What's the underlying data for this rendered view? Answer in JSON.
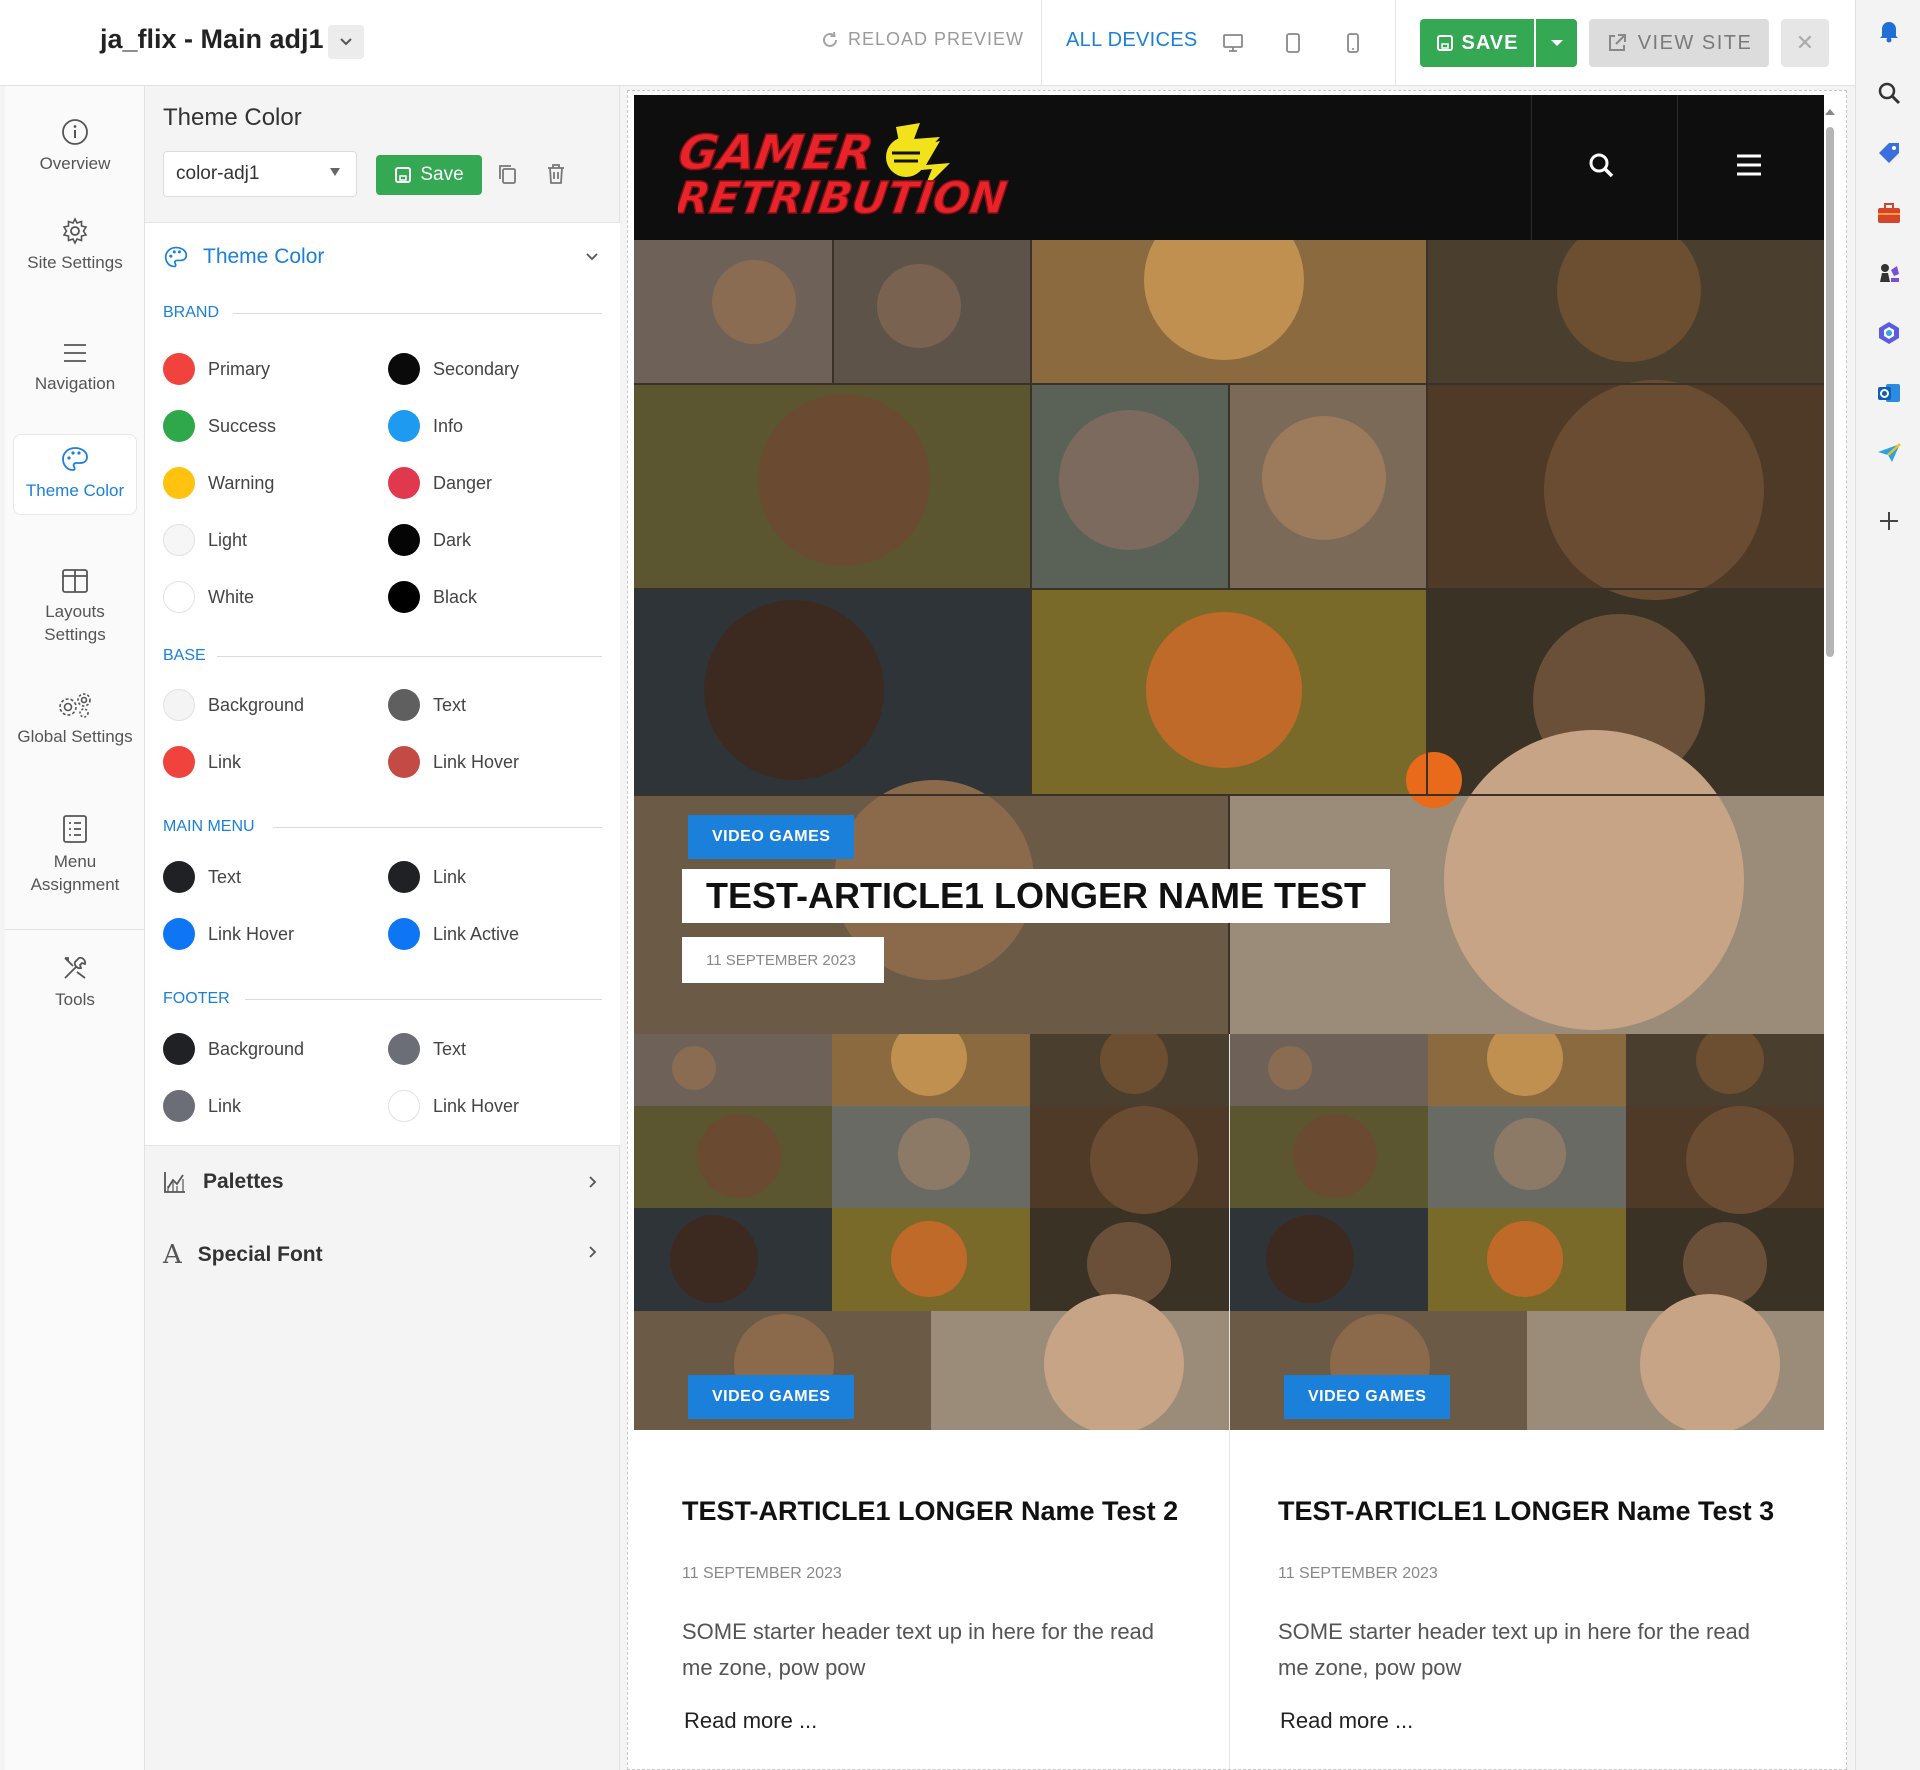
{
  "topbar": {
    "site_title": "ja_flix - Main adj1",
    "reload_label": "RELOAD PREVIEW",
    "devices_label": "ALL DEVICES",
    "save_label": "SAVE",
    "view_site_label": "VIEW SITE"
  },
  "leftnav": {
    "items": [
      {
        "label": "Overview"
      },
      {
        "label": "Site Settings"
      },
      {
        "label": "Navigation"
      },
      {
        "label": "Theme Color"
      },
      {
        "label": "Layouts Settings"
      },
      {
        "label": "Global Settings"
      },
      {
        "label": "Menu Assignment"
      },
      {
        "label": "Tools"
      }
    ]
  },
  "panel": {
    "title": "Theme Color",
    "selected_profile": "color-adj1",
    "save_label": "Save",
    "section_title": "Theme Color",
    "groups": [
      {
        "label": "BRAND",
        "swatches": [
          {
            "name": "Primary",
            "color": "#f1433d"
          },
          {
            "name": "Secondary",
            "color": "#0a0a0a"
          },
          {
            "name": "Success",
            "color": "#2ea84a"
          },
          {
            "name": "Info",
            "color": "#1e9bf0"
          },
          {
            "name": "Warning",
            "color": "#ffc20e"
          },
          {
            "name": "Danger",
            "color": "#e0394e"
          },
          {
            "name": "Light",
            "color": "#f6f6f6"
          },
          {
            "name": "Dark",
            "color": "#050505"
          },
          {
            "name": "White",
            "color": "#ffffff"
          },
          {
            "name": "Black",
            "color": "#000000"
          }
        ]
      },
      {
        "label": "BASE",
        "swatches": [
          {
            "name": "Background",
            "color": "#f4f4f4"
          },
          {
            "name": "Text",
            "color": "#5f5f5f"
          },
          {
            "name": "Link",
            "color": "#f1433d"
          },
          {
            "name": "Link Hover",
            "color": "#c44b45"
          }
        ]
      },
      {
        "label": "MAIN MENU",
        "swatches": [
          {
            "name": "Text",
            "color": "#1f2125"
          },
          {
            "name": "Link",
            "color": "#1f2125"
          },
          {
            "name": "Link Hover",
            "color": "#0e76f5"
          },
          {
            "name": "Link Active",
            "color": "#0e76f5"
          }
        ]
      },
      {
        "label": "FOOTER",
        "swatches": [
          {
            "name": "Background",
            "color": "#1f2125"
          },
          {
            "name": "Text",
            "color": "#6b6e76"
          },
          {
            "name": "Link",
            "color": "#6b6e76"
          },
          {
            "name": "Link Hover",
            "color": "#ffffff"
          }
        ]
      }
    ],
    "palettes_label": "Palettes",
    "special_font_label": "Special Font"
  },
  "preview": {
    "logo_line1": "GAMER",
    "logo_line2": "RETRIBUTION",
    "hero": {
      "badge": "VIDEO GAMES",
      "title": "TEST-ARTICLE1 LONGER NAME TEST",
      "date": "11 SEPTEMBER 2023"
    },
    "cards": [
      {
        "badge": "VIDEO GAMES",
        "title": "TEST-ARTICLE1 LONGER Name Test 2",
        "date": "11 SEPTEMBER 2023",
        "text": "SOME starter header text up in here for the read me zone, pow pow",
        "read_more": "Read more ..."
      },
      {
        "badge": "VIDEO GAMES",
        "title": "TEST-ARTICLE1 LONGER Name Test 3",
        "date": "11 SEPTEMBER 2023",
        "text": "SOME starter header text up in here for the read me zone, pow pow",
        "read_more": "Read more ..."
      }
    ]
  },
  "colors": {
    "accent": "#1a80d9",
    "save_green": "#34a853"
  }
}
